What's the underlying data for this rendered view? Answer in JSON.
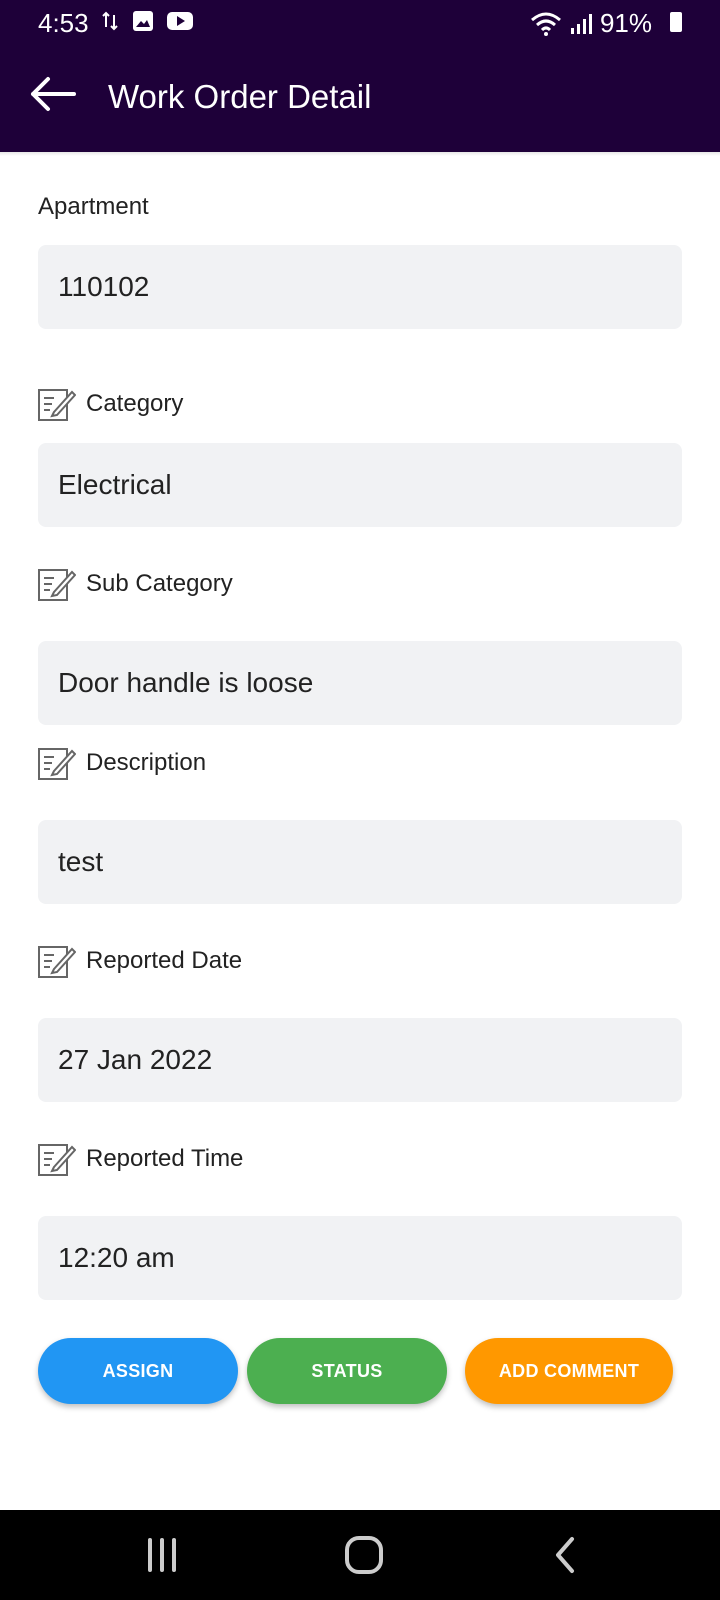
{
  "status_bar": {
    "time": "4:53",
    "battery": "91%",
    "icons": [
      "data-transfer-icon",
      "image-icon",
      "youtube-icon",
      "wifi-icon",
      "signal-icon",
      "battery-icon"
    ]
  },
  "app_bar": {
    "title": "Work Order Detail",
    "background": "#1e0039"
  },
  "form": {
    "apartment_label": "Apartment",
    "apartment_value": "110102",
    "category_label": "Category",
    "category_value": "Electrical",
    "subcategory_label": "Sub Category",
    "subcategory_value": "Door handle is loose",
    "description_label": "Description",
    "description_value": "test",
    "reported_date_label": "Reported Date",
    "reported_date_value": "27 Jan 2022",
    "reported_time_label": "Reported Time",
    "reported_time_value": "12:20 am"
  },
  "actions": {
    "assign_label": "ASSIGN",
    "assign_color": "#2196f3",
    "status_label": "STATUS",
    "status_color": "#4caf50",
    "add_comment_label": "ADD COMMENT",
    "add_comment_color": "#ff9800"
  },
  "nav_bar": {
    "icons": [
      "recent-apps-icon",
      "home-icon",
      "back-icon"
    ]
  }
}
